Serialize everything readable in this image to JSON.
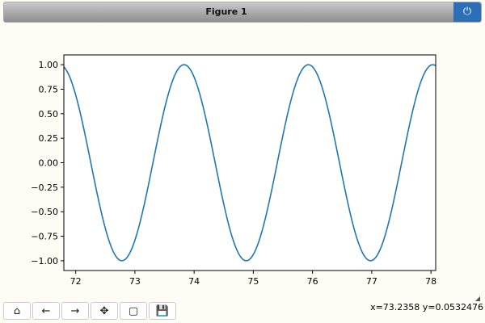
{
  "window": {
    "title": "Figure 1",
    "close_icon": "power-icon"
  },
  "toolbar": [
    {
      "name": "home",
      "icon": "home-icon",
      "glyph": "⌂"
    },
    {
      "name": "back",
      "icon": "arrow-left-icon",
      "glyph": "←"
    },
    {
      "name": "forward",
      "icon": "arrow-right-icon",
      "glyph": "→"
    },
    {
      "name": "pan",
      "icon": "move-icon",
      "glyph": "✥"
    },
    {
      "name": "zoom",
      "icon": "zoom-rect-icon",
      "glyph": "▢"
    },
    {
      "name": "save",
      "icon": "save-icon",
      "glyph": "💾"
    }
  ],
  "status": {
    "coords": "x=73.2358 y=0.0532476"
  },
  "chart_data": {
    "type": "line",
    "title": "",
    "xlabel": "",
    "ylabel": "",
    "xlim": [
      71.8,
      78.08
    ],
    "ylim": [
      -1.1,
      1.1
    ],
    "xticks": [
      72,
      73,
      74,
      75,
      76,
      77,
      78
    ],
    "xtick_labels": [
      "72",
      "73",
      "74",
      "75",
      "76",
      "77",
      "78"
    ],
    "yticks": [
      1,
      0.75,
      0.5,
      0.25,
      0,
      -0.25,
      -0.5,
      -0.75,
      -1
    ],
    "ytick_labels": [
      "1.00",
      "0.75",
      "0.50",
      "0.25",
      "0.00",
      "−0.25",
      "−0.50",
      "−0.75",
      "−1.00"
    ],
    "series": [
      {
        "name": "cosine",
        "color": "#1f77b4",
        "function": {
          "form": "A*cos(2*pi*(x-x0)/T)",
          "A": 1,
          "T": 2.1,
          "x0": 73.83
        },
        "x_range": [
          71.8,
          78.08
        ]
      }
    ],
    "grid": false
  }
}
